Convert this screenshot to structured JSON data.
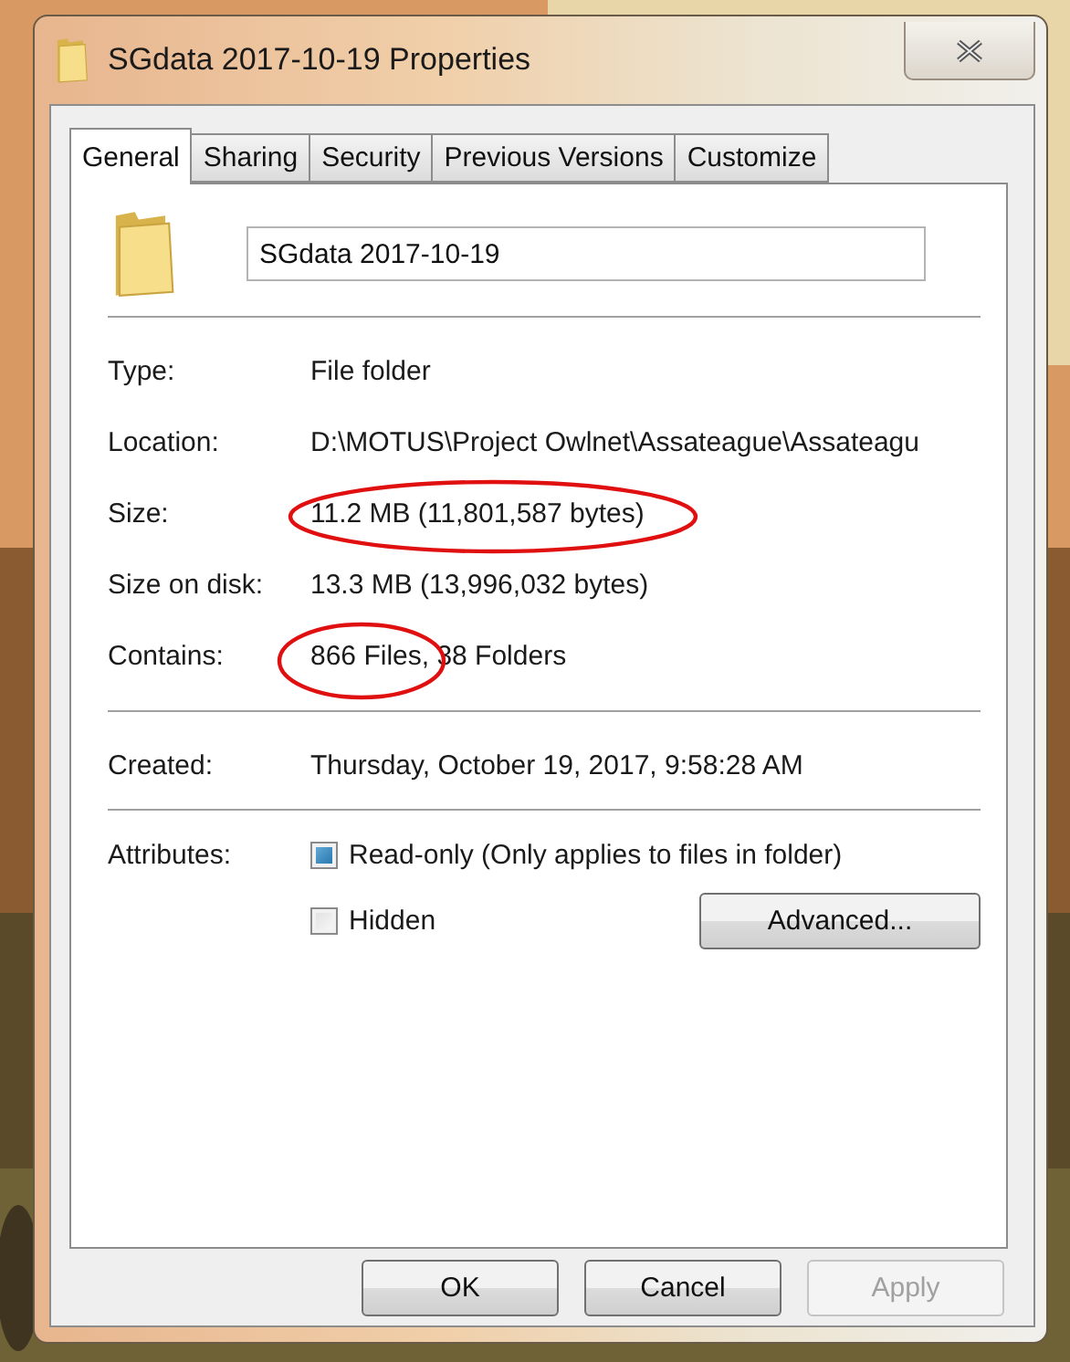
{
  "window": {
    "title": "SGdata 2017-10-19 Properties"
  },
  "tabs": [
    {
      "label": "General",
      "selected": true
    },
    {
      "label": "Sharing",
      "selected": false
    },
    {
      "label": "Security",
      "selected": false
    },
    {
      "label": "Previous Versions",
      "selected": false
    },
    {
      "label": "Customize",
      "selected": false
    }
  ],
  "name_field": {
    "value": "SGdata 2017-10-19"
  },
  "details": [
    {
      "kind": "plain",
      "label": "Type:",
      "value": "File folder"
    },
    {
      "kind": "plain",
      "label": "Location:",
      "value": "D:\\MOTUS\\Project Owlnet\\Assateague\\Assateagu"
    },
    {
      "kind": "circled",
      "label": "Size:",
      "value": "11.2 MB (11,801,587 bytes)"
    },
    {
      "kind": "plain",
      "label": "Size on disk:",
      "value": "13.3 MB (13,996,032 bytes)"
    },
    {
      "kind": "startcircled",
      "label": "Contains:",
      "value": "866 Files, 38 Folders"
    }
  ],
  "created": {
    "label": "Created:",
    "value": "Thursday, October 19, 2017, 9:58:28 AM"
  },
  "attributes": {
    "label": "Attributes:",
    "options": [
      {
        "label": "Read-only (Only applies to files in folder)",
        "checked": true
      },
      {
        "label": "Hidden",
        "checked": false
      }
    ],
    "advanced_button": "Advanced..."
  },
  "buttons": [
    {
      "label": "OK",
      "disabled": false
    },
    {
      "label": "Cancel",
      "disabled": false
    },
    {
      "label": "Apply",
      "disabled": true
    }
  ]
}
